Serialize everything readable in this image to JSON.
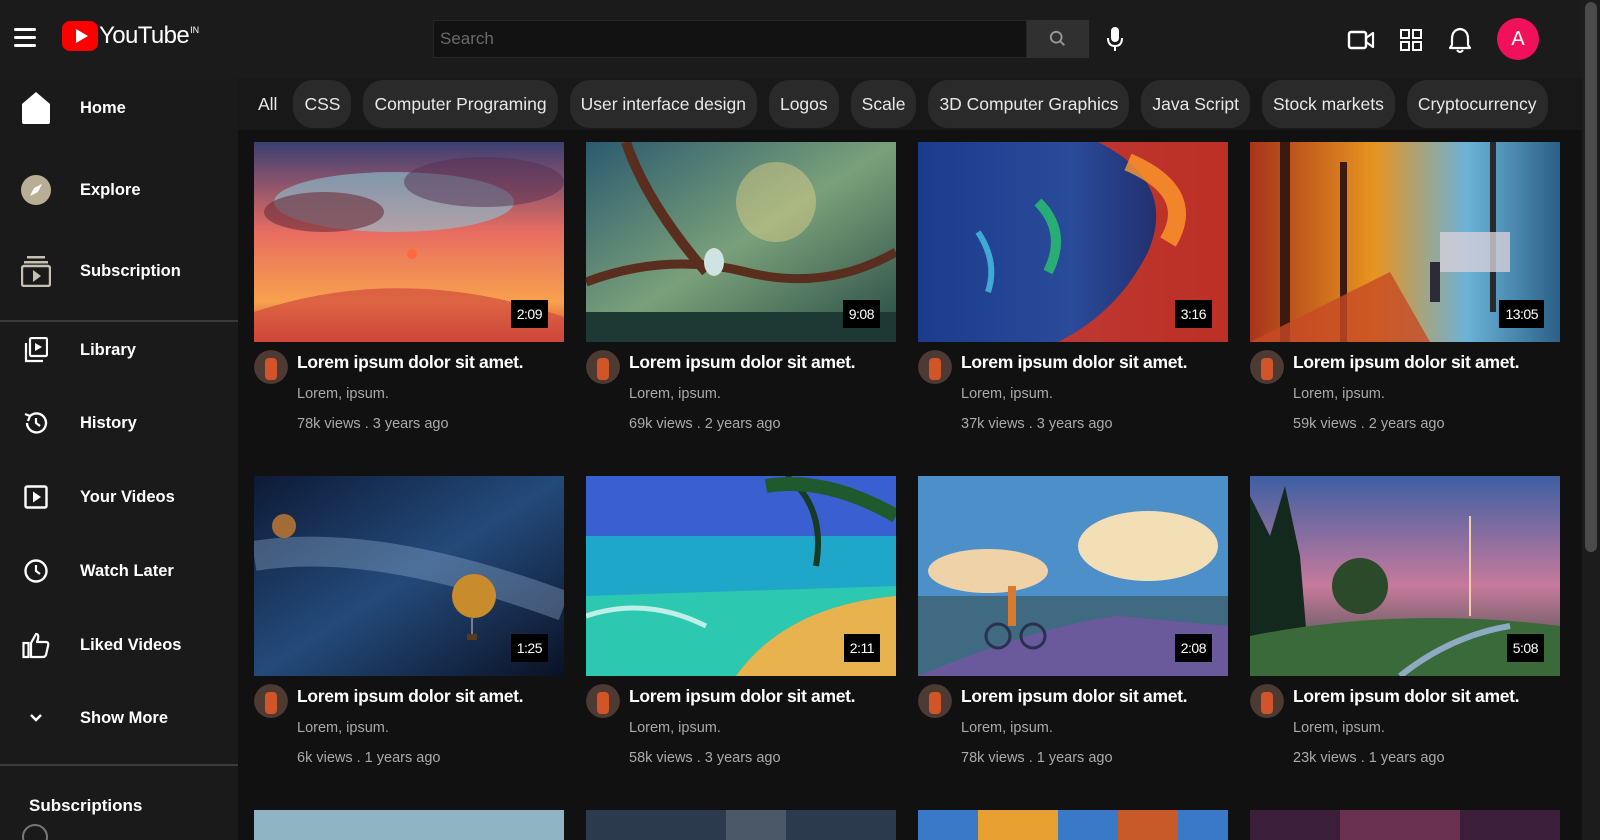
{
  "header": {
    "logo_text": "YouTube",
    "logo_sup": "IN",
    "search_placeholder": "Search",
    "avatar_letter": "A",
    "accent": "#f0115a",
    "brand_red": "#ff0000"
  },
  "sidebar": {
    "items": [
      {
        "label": "Home",
        "icon": "home-icon"
      },
      {
        "label": "Explore",
        "icon": "compass-icon"
      },
      {
        "label": "Subscription",
        "icon": "subscriptions-icon"
      },
      {
        "label": "Library",
        "icon": "library-icon"
      },
      {
        "label": "History",
        "icon": "history-icon"
      },
      {
        "label": "Your Videos",
        "icon": "play-square-icon"
      },
      {
        "label": "Watch Later",
        "icon": "clock-icon"
      },
      {
        "label": "Liked Videos",
        "icon": "thumbs-up-icon"
      },
      {
        "label": "Show More",
        "icon": "chevron-down-icon"
      }
    ],
    "subscriptions_heading": "Subscriptions"
  },
  "chips": [
    "All",
    "CSS",
    "Computer Programing",
    "User interface design",
    "Logos",
    "Scale",
    "3D Computer Graphics",
    "Java Script",
    "Stock markets",
    "Cryptocurrency"
  ],
  "videos": [
    {
      "title": "Lorem ipsum dolor sit amet.",
      "channel": "Lorem, ipsum.",
      "stats": "78k views . 3 years ago",
      "duration": "2:09"
    },
    {
      "title": "Lorem ipsum dolor sit amet.",
      "channel": "Lorem, ipsum.",
      "stats": "69k views . 2 years ago",
      "duration": "9:08"
    },
    {
      "title": "Lorem ipsum dolor sit amet.",
      "channel": "Lorem, ipsum.",
      "stats": "37k views . 3 years ago",
      "duration": "3:16"
    },
    {
      "title": "Lorem ipsum dolor sit amet.",
      "channel": "Lorem, ipsum.",
      "stats": "59k views . 2 years ago",
      "duration": "13:05"
    },
    {
      "title": "Lorem ipsum dolor sit amet.",
      "channel": "Lorem, ipsum.",
      "stats": "6k views . 1 years ago",
      "duration": "1:25"
    },
    {
      "title": "Lorem ipsum dolor sit amet.",
      "channel": "Lorem, ipsum.",
      "stats": "58k views . 3 years ago",
      "duration": "2:11"
    },
    {
      "title": "Lorem ipsum dolor sit amet.",
      "channel": "Lorem, ipsum.",
      "stats": "78k views . 1 years ago",
      "duration": "2:08"
    },
    {
      "title": "Lorem ipsum dolor sit amet.",
      "channel": "Lorem, ipsum.",
      "stats": "23k views . 1 years ago",
      "duration": "5:08"
    }
  ]
}
